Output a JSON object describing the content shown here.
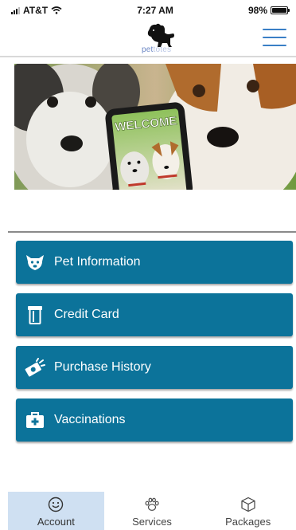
{
  "status_bar": {
    "carrier": "AT&T",
    "time": "7:27 AM",
    "battery_text": "98%",
    "battery_level": 0.98
  },
  "header": {
    "logo_text_a": "pet",
    "logo_text_b": "totes"
  },
  "hero": {
    "sign_text": "WELCOME"
  },
  "menu": {
    "items": [
      {
        "label": "Pet Information",
        "icon": "dog-face-icon"
      },
      {
        "label": "Credit Card",
        "icon": "credit-card-icon"
      },
      {
        "label": "Purchase History",
        "icon": "money-icon"
      },
      {
        "label": "Vaccinations",
        "icon": "medical-kit-icon"
      }
    ]
  },
  "tabs": [
    {
      "label": "Account",
      "icon": "smiley-icon",
      "active": true
    },
    {
      "label": "Services",
      "icon": "paw-icon",
      "active": false
    },
    {
      "label": "Packages",
      "icon": "box-icon",
      "active": false
    }
  ],
  "colors": {
    "card": "#0c739a",
    "tab_active": "#cfe0f2",
    "menu_icon": "#3a7fc6"
  }
}
